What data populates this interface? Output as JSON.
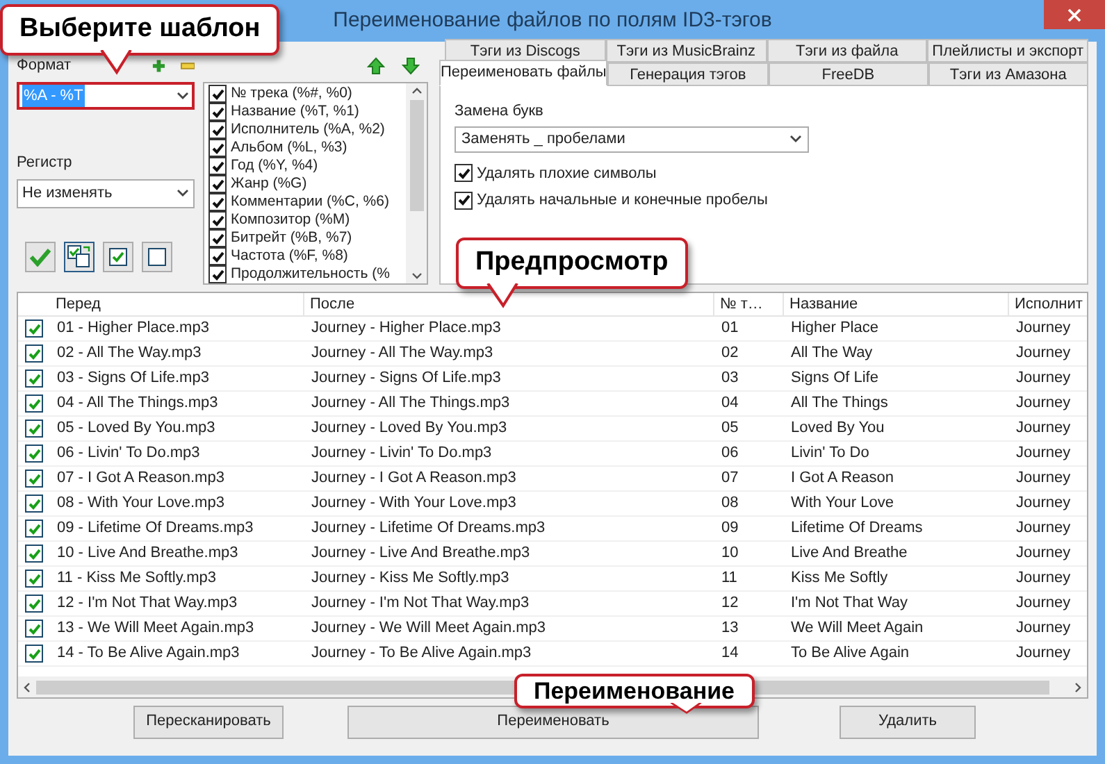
{
  "window": {
    "title": "Переименование файлов по полям ID3-тэгов"
  },
  "callouts": [
    {
      "text": "Выберите шаблон"
    },
    {
      "text": "Предпросмотр"
    },
    {
      "text": "Переименование"
    }
  ],
  "format": {
    "label": "Формат",
    "value": "%A - %T"
  },
  "case": {
    "label": "Регистр",
    "value": "Не изменять"
  },
  "fields": [
    {
      "label": "№ трека (%#, %0)",
      "checked": true
    },
    {
      "label": "Название (%T, %1)",
      "checked": true
    },
    {
      "label": "Исполнитель (%A, %2)",
      "checked": true
    },
    {
      "label": "Альбом (%L, %3)",
      "checked": true
    },
    {
      "label": "Год (%Y, %4)",
      "checked": true
    },
    {
      "label": "Жанр (%G)",
      "checked": true
    },
    {
      "label": "Комментарии (%C, %6)",
      "checked": true
    },
    {
      "label": "Композитор (%M)",
      "checked": true
    },
    {
      "label": "Битрейт (%B, %7)",
      "checked": true
    },
    {
      "label": "Частота (%F, %8)",
      "checked": true
    },
    {
      "label": "Продолжительность (%",
      "checked": true
    }
  ],
  "tab_rows": [
    [
      {
        "label": "Тэги из Discogs",
        "selected": false
      },
      {
        "label": "Тэги из MusicBrainz",
        "selected": false
      },
      {
        "label": "Тэги из файла",
        "selected": false
      },
      {
        "label": "Плейлисты и экспорт",
        "selected": false
      }
    ],
    [
      {
        "label": "Переименовать файлы",
        "selected": true
      },
      {
        "label": "Генерация тэгов",
        "selected": false
      },
      {
        "label": "FreeDB",
        "selected": false
      },
      {
        "label": "Тэги из Амазона",
        "selected": false
      }
    ]
  ],
  "rename_panel": {
    "replace_label": "Замена букв",
    "replace_value": "Заменять _ пробелами",
    "options": [
      {
        "label": "Удалять плохие символы",
        "checked": true
      },
      {
        "label": "Удалять начальные и конечные пробелы",
        "checked": true
      }
    ]
  },
  "table": {
    "columns": [
      "Перед",
      "После",
      "№ т…",
      "Название",
      "Исполнит"
    ],
    "rows": [
      {
        "checked": true,
        "cells": [
          "01 - Higher Place.mp3",
          "Journey - Higher Place.mp3",
          "01",
          "Higher Place",
          "Journey"
        ]
      },
      {
        "checked": true,
        "cells": [
          "02 - All The Way.mp3",
          "Journey - All The Way.mp3",
          "02",
          "All The Way",
          "Journey"
        ]
      },
      {
        "checked": true,
        "cells": [
          "03 - Signs Of Life.mp3",
          "Journey - Signs Of Life.mp3",
          "03",
          "Signs Of Life",
          "Journey"
        ]
      },
      {
        "checked": true,
        "cells": [
          "04 - All The Things.mp3",
          "Journey - All The Things.mp3",
          "04",
          "All The Things",
          "Journey"
        ]
      },
      {
        "checked": true,
        "cells": [
          "05 - Loved By You.mp3",
          "Journey - Loved By You.mp3",
          "05",
          "Loved By You",
          "Journey"
        ]
      },
      {
        "checked": true,
        "cells": [
          "06 - Livin' To Do.mp3",
          "Journey - Livin' To Do.mp3",
          "06",
          "Livin' To Do",
          "Journey"
        ]
      },
      {
        "checked": true,
        "cells": [
          "07 - I Got A Reason.mp3",
          "Journey - I Got A Reason.mp3",
          "07",
          "I Got A Reason",
          "Journey"
        ]
      },
      {
        "checked": true,
        "cells": [
          "08 - With Your Love.mp3",
          "Journey - With Your Love.mp3",
          "08",
          "With Your Love",
          "Journey"
        ]
      },
      {
        "checked": true,
        "cells": [
          "09 - Lifetime Of Dreams.mp3",
          "Journey - Lifetime Of Dreams.mp3",
          "09",
          "Lifetime Of Dreams",
          "Journey"
        ]
      },
      {
        "checked": true,
        "cells": [
          "10 - Live And Breathe.mp3",
          "Journey - Live And Breathe.mp3",
          "10",
          "Live And Breathe",
          "Journey"
        ]
      },
      {
        "checked": true,
        "cells": [
          "11 - Kiss Me Softly.mp3",
          "Journey - Kiss Me Softly.mp3",
          "11",
          "Kiss Me Softly",
          "Journey"
        ]
      },
      {
        "checked": true,
        "cells": [
          "12 - I'm Not That Way.mp3",
          "Journey - I'm Not That Way.mp3",
          "12",
          "I'm Not That Way",
          "Journey"
        ]
      },
      {
        "checked": true,
        "cells": [
          "13 - We Will Meet Again.mp3",
          "Journey - We Will Meet Again.mp3",
          "13",
          "We Will Meet Again",
          "Journey"
        ]
      },
      {
        "checked": true,
        "cells": [
          "14 - To Be Alive Again.mp3",
          "Journey - To Be Alive Again.mp3",
          "14",
          "To Be Alive Again",
          "Journey"
        ]
      }
    ]
  },
  "buttons": [
    "Пересканировать",
    "Переименовать",
    "Удалить"
  ]
}
